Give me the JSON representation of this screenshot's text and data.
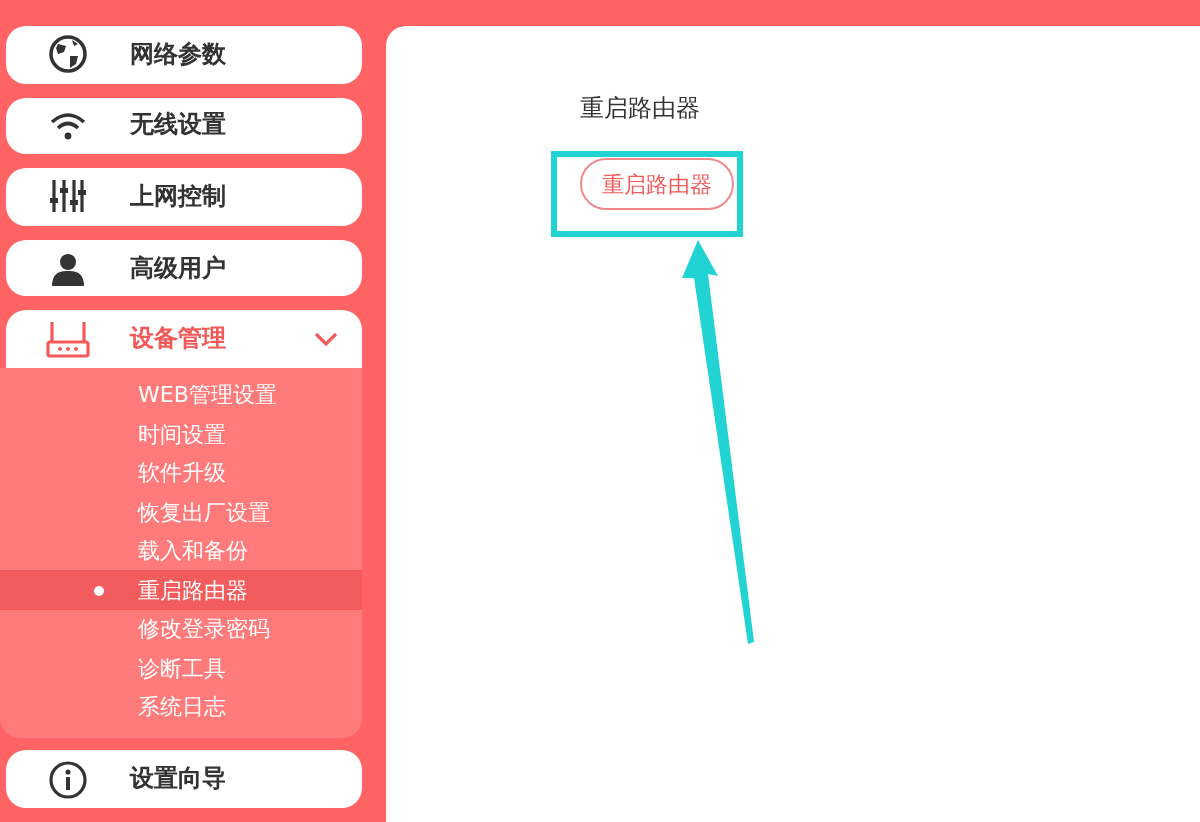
{
  "sidebar": {
    "items": [
      {
        "label": "网络参数",
        "selected": false,
        "expanded": false
      },
      {
        "label": "无线设置",
        "selected": false,
        "expanded": false
      },
      {
        "label": "上网控制",
        "selected": false,
        "expanded": false
      },
      {
        "label": "高级用户",
        "selected": false,
        "expanded": false
      },
      {
        "label": "设备管理",
        "selected": true,
        "expanded": true,
        "children": [
          {
            "label": "WEB管理设置",
            "selected": false
          },
          {
            "label": "时间设置",
            "selected": false
          },
          {
            "label": "软件升级",
            "selected": false
          },
          {
            "label": "恢复出厂设置",
            "selected": false
          },
          {
            "label": "载入和备份",
            "selected": false
          },
          {
            "label": "重启路由器",
            "selected": true
          },
          {
            "label": "修改登录密码",
            "selected": false
          },
          {
            "label": "诊断工具",
            "selected": false
          },
          {
            "label": "系统日志",
            "selected": false
          }
        ]
      },
      {
        "label": "设置向导",
        "selected": false,
        "expanded": false
      }
    ]
  },
  "main": {
    "title": "重启路由器",
    "button": "重启路由器"
  }
}
